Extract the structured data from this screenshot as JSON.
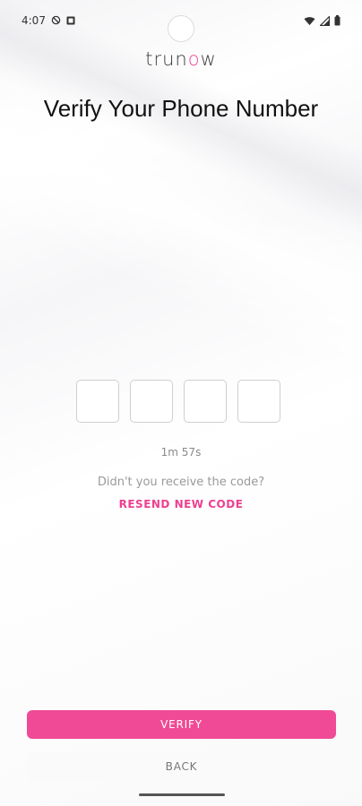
{
  "status_bar": {
    "time": "4:07",
    "icons": [
      "do-not-disturb-icon",
      "notification-icon",
      "wifi-icon",
      "signal-icon",
      "battery-icon"
    ]
  },
  "logo": {
    "prefix": "trun",
    "pin_letter": "o",
    "suffix": "w"
  },
  "title": "Verify Your Phone Number",
  "otp": {
    "values": [
      "",
      "",
      "",
      ""
    ]
  },
  "timer": "1m 57s",
  "resend_prompt": "Didn't you receive the code?",
  "resend_link": "RESEND NEW CODE",
  "buttons": {
    "verify": "VERIFY",
    "back": "BACK"
  },
  "colors": {
    "accent": "#F04A96",
    "text_dark": "#111111"
  }
}
